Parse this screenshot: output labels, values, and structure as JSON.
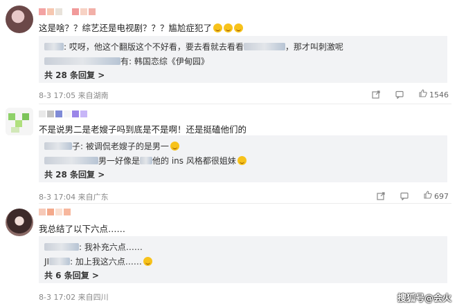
{
  "comments": [
    {
      "text": "这是啥？？综艺还是电视剧？？？尴尬症犯了",
      "replies": [
        {
          "text": ": 哎呀，他这个翻版这个不好看，要去看就去看看",
          "tail": "，那才叫刺激呢"
        },
        {
          "text": "有: 韩国恋综《伊甸园》"
        }
      ],
      "more": "共 28 条回复 >",
      "meta": "8-3 17:05  来自湖南",
      "likes": "1546"
    },
    {
      "text": "不是说男二是老嫂子吗到底是不是啊！还是挺磕他们的",
      "replies": [
        {
          "text": "子: 被调侃老嫂子的是男一"
        },
        {
          "text": "男一好像是",
          "tail": "他的 ins 风格都很姐妹"
        }
      ],
      "more": "共 28 条回复 >",
      "meta": "8-3 17:04  来自广东",
      "likes": "697"
    },
    {
      "text": "我总结了以下六点……",
      "replies": [
        {
          "text": ": 我补充六点……"
        },
        {
          "prefix": "JI",
          "text": ": 加上我这六点……"
        }
      ],
      "more": "共 6 条回复 >",
      "meta": "8-3 17:02  来自四川",
      "likes": ""
    }
  ],
  "watermark": "搜狐号@会火",
  "icons": [
    "share-icon",
    "comment-icon",
    "like-icon"
  ]
}
